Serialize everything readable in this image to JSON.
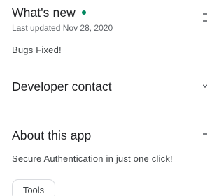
{
  "whats_new": {
    "title": "What's new",
    "updated": "Last updated Nov 28, 2020",
    "notes": "Bugs Fixed!"
  },
  "developer_contact": {
    "title": "Developer contact"
  },
  "about": {
    "title": "About this app",
    "description": "Secure Authentication in just one click!"
  },
  "tags": [
    {
      "label": "Tools"
    }
  ],
  "colors": {
    "accent_dot": "#01875f",
    "text_primary": "#202124",
    "text_secondary": "#5f6368"
  },
  "icons": {
    "whats_new": "arrow-right-icon",
    "developer_contact": "chevron-down-icon",
    "about": "arrow-right-icon"
  }
}
